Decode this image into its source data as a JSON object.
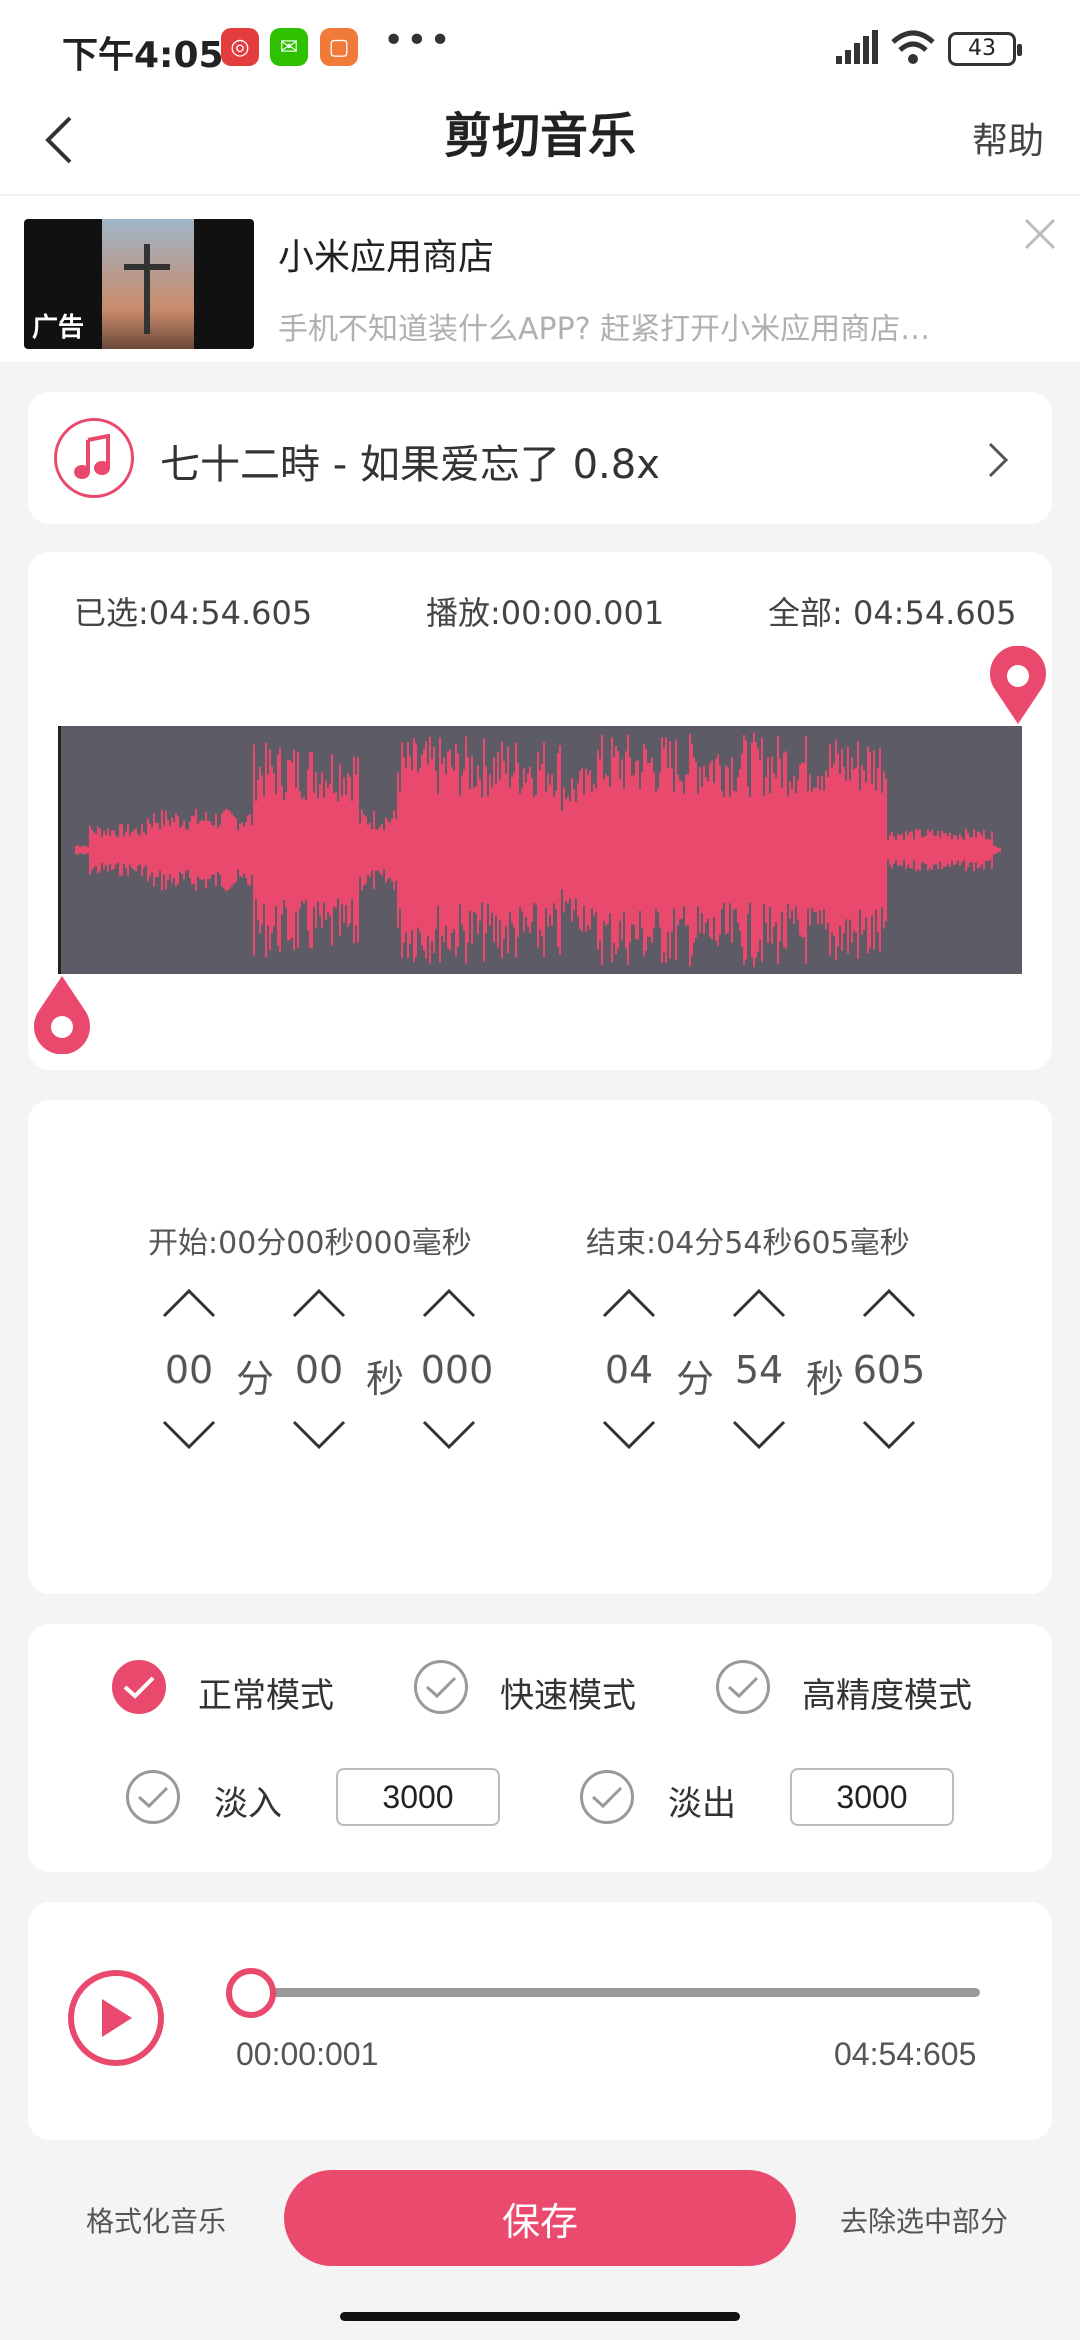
{
  "status": {
    "time": "下午4:05",
    "battery": "43"
  },
  "header": {
    "title": "剪切音乐",
    "help": "帮助"
  },
  "ad": {
    "tag": "广告",
    "title": "小米应用商店",
    "desc": "手机不知道装什么APP? 赶紧打开小米应用商店…"
  },
  "song": {
    "title": "七十二時 - 如果爱忘了 0.8x"
  },
  "wave_info": {
    "selected": "已选:04:54.605",
    "play": "播放:00:00.001",
    "total": "全部: 04:54.605"
  },
  "start": {
    "label": "开始:00分00秒000毫秒",
    "min": "00",
    "sec": "00",
    "ms": "000"
  },
  "end": {
    "label": "结束:04分54秒605毫秒",
    "min": "04",
    "sec": "54",
    "ms": "605"
  },
  "units": {
    "min": "分",
    "sec": "秒"
  },
  "modes": [
    {
      "label": "正常模式",
      "checked": true
    },
    {
      "label": "快速模式",
      "checked": false
    },
    {
      "label": "高精度模式",
      "checked": false
    }
  ],
  "fade": {
    "in_label": "淡入",
    "in_value": "3000",
    "out_label": "淡出",
    "out_value": "3000"
  },
  "player": {
    "current": "00:00:001",
    "total": "04:54:605",
    "progress": 0.0
  },
  "actions": {
    "format": "格式化音乐",
    "save": "保存",
    "remove": "去除选中部分"
  },
  "colors": {
    "accent": "#e9496c",
    "wave_bg": "#5c5b66"
  }
}
